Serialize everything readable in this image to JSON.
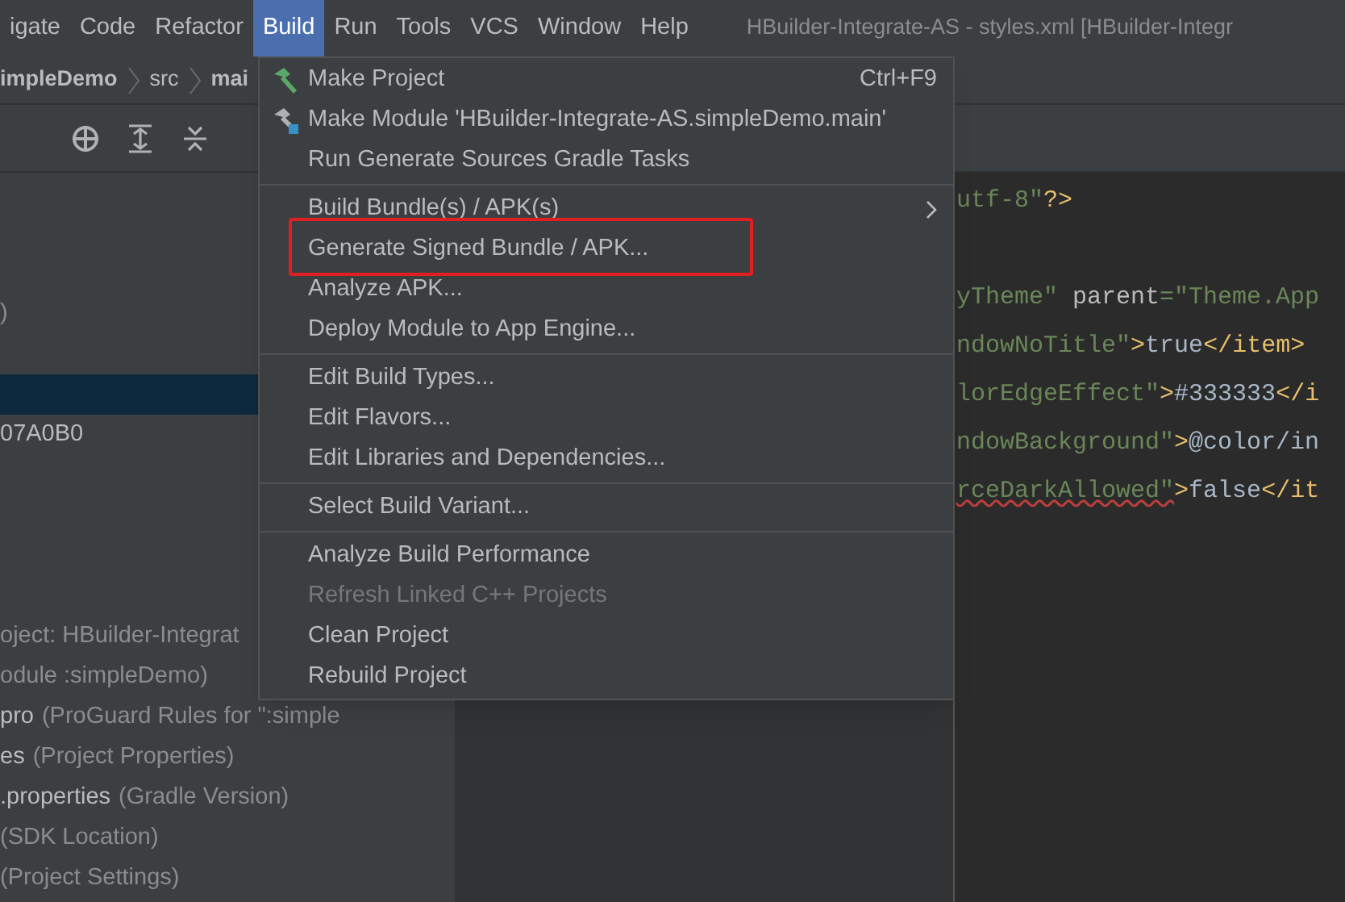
{
  "menu_bar": {
    "items": [
      {
        "label": "igate",
        "selected": false
      },
      {
        "label": "Code",
        "selected": false
      },
      {
        "label": "Refactor",
        "selected": false
      },
      {
        "label": "Build",
        "selected": true
      },
      {
        "label": "Run",
        "selected": false
      },
      {
        "label": "Tools",
        "selected": false
      },
      {
        "label": "VCS",
        "selected": false
      },
      {
        "label": "Window",
        "selected": false
      },
      {
        "label": "Help",
        "selected": false
      }
    ],
    "title": "HBuilder-Integrate-AS - styles.xml [HBuilder-Integr"
  },
  "breadcrumb": [
    {
      "label": "impleDemo",
      "bold": true
    },
    {
      "label": "src",
      "bold": false
    },
    {
      "label": "mai",
      "bold": true
    }
  ],
  "project_tree": {
    "rows": [
      {
        "detail": ")",
        "selected": false
      },
      {
        "selected": true
      },
      {
        "name": "07A0B0",
        "selected": false
      },
      {
        "detail": "oject: HBuilder-Integrat",
        "selected": false
      },
      {
        "detail": "odule :simpleDemo)",
        "selected": false
      },
      {
        "name": "pro",
        "detail": "(ProGuard Rules for \":simple",
        "selected": false
      },
      {
        "name": "es",
        "detail": "(Project Properties)",
        "selected": false
      },
      {
        "name": ".properties",
        "detail": "(Gradle Version)",
        "selected": false
      },
      {
        "detail": "(SDK Location)",
        "selected": false
      },
      {
        "detail": "(Project Settings)",
        "selected": false
      }
    ]
  },
  "editor": {
    "lines": [
      [
        {
          "kind": "value",
          "text": "utf-8\""
        },
        {
          "kind": "tag",
          "text": "?>"
        }
      ],
      [
        {
          "kind": "value",
          "text": "yTheme\""
        },
        {
          "kind": "attr",
          "text": " parent"
        },
        {
          "kind": "value",
          "text": "=\"Theme.App"
        }
      ],
      [
        {
          "kind": "value",
          "text": "ndowNoTitle\""
        },
        {
          "kind": "tag",
          "text": ">"
        },
        {
          "kind": "text",
          "text": "true"
        },
        {
          "kind": "tag",
          "text": "</item>"
        }
      ],
      [
        {
          "kind": "value",
          "text": "lorEdgeEffect\""
        },
        {
          "kind": "tag",
          "text": ">"
        },
        {
          "kind": "text",
          "text": "#333333"
        },
        {
          "kind": "tag",
          "text": "</i"
        }
      ],
      [
        {
          "kind": "value",
          "text": "ndowBackground\""
        },
        {
          "kind": "tag",
          "text": ">"
        },
        {
          "kind": "text",
          "text": "@color/in"
        }
      ],
      [
        {
          "kind": "value",
          "text": "rceDarkAllowed\"",
          "underlined": true
        },
        {
          "kind": "tag",
          "text": ">"
        },
        {
          "kind": "text",
          "text": "false"
        },
        {
          "kind": "tag",
          "text": "</it"
        }
      ]
    ]
  },
  "build_menu": {
    "groups": [
      [
        {
          "label": "Make Project",
          "shortcut": "Ctrl+F9",
          "disabled": false
        },
        {
          "label": "Make Module 'HBuilder-Integrate-AS.simpleDemo.main'",
          "disabled": false
        },
        {
          "label": "Run Generate Sources Gradle Tasks",
          "disabled": false
        }
      ],
      [
        {
          "label": "Build Bundle(s) / APK(s)",
          "submenu": true,
          "disabled": false
        },
        {
          "label": "Generate Signed Bundle / APK...",
          "highlighted": true,
          "disabled": false
        },
        {
          "label": "Analyze APK...",
          "disabled": false
        },
        {
          "label": "Deploy Module to App Engine...",
          "disabled": false
        }
      ],
      [
        {
          "label": "Edit Build Types...",
          "disabled": false
        },
        {
          "label": "Edit Flavors...",
          "disabled": false
        },
        {
          "label": "Edit Libraries and Dependencies...",
          "disabled": false
        }
      ],
      [
        {
          "label": "Select Build Variant...",
          "disabled": false
        }
      ],
      [
        {
          "label": "Analyze Build Performance",
          "disabled": false
        },
        {
          "label": "Refresh Linked C++ Projects",
          "disabled": true
        },
        {
          "label": "Clean Project",
          "disabled": false
        },
        {
          "label": "Rebuild Project",
          "disabled": false
        }
      ]
    ]
  }
}
